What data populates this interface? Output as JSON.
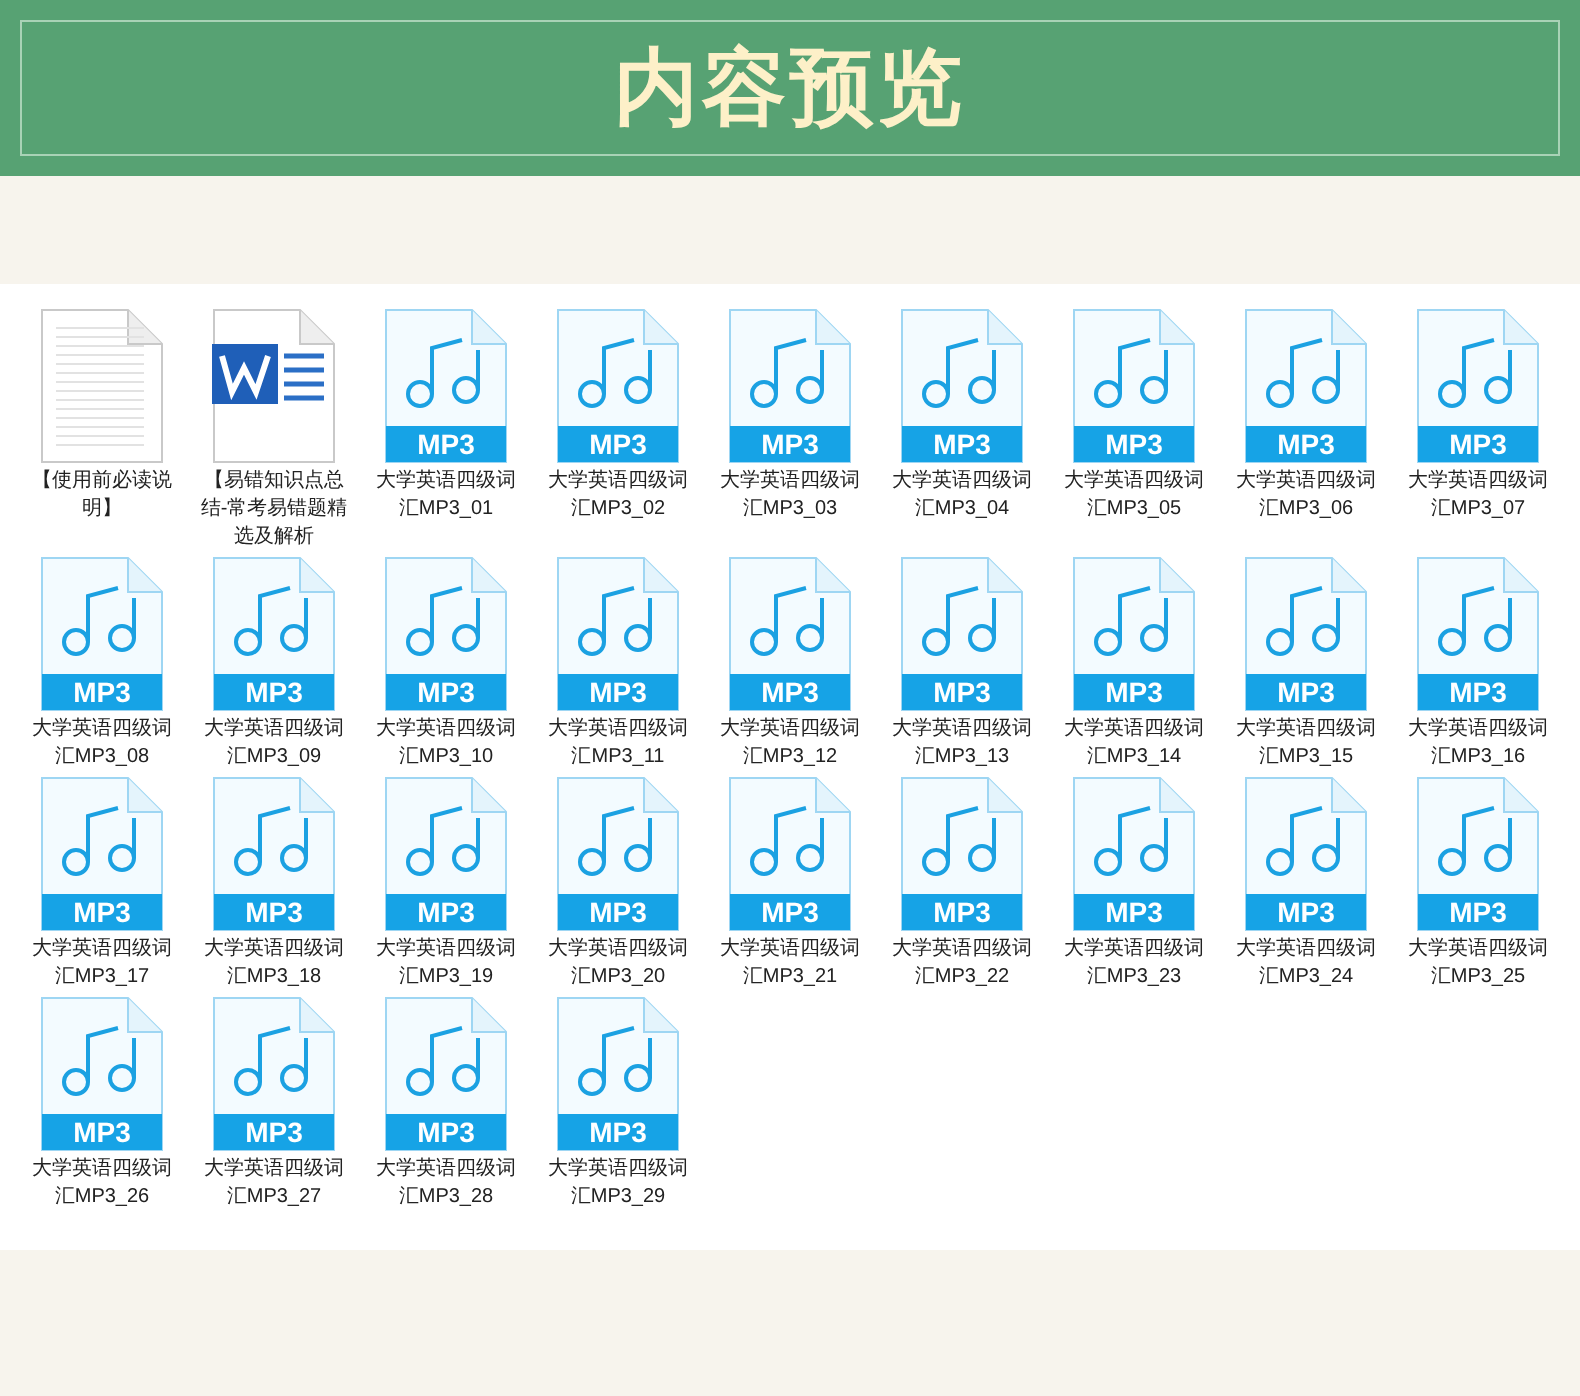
{
  "header": {
    "title": "内容预览"
  },
  "files": [
    {
      "kind": "blank",
      "label": "【使用前必读说明】"
    },
    {
      "kind": "word",
      "label": "【易错知识点总结-常考易错题精选及解析"
    },
    {
      "kind": "mp3",
      "badge": "MP3",
      "label": "大学英语四级词汇MP3_01"
    },
    {
      "kind": "mp3",
      "badge": "MP3",
      "label": "大学英语四级词汇MP3_02"
    },
    {
      "kind": "mp3",
      "badge": "MP3",
      "label": "大学英语四级词汇MP3_03"
    },
    {
      "kind": "mp3",
      "badge": "MP3",
      "label": "大学英语四级词汇MP3_04"
    },
    {
      "kind": "mp3",
      "badge": "MP3",
      "label": "大学英语四级词汇MP3_05"
    },
    {
      "kind": "mp3",
      "badge": "MP3",
      "label": "大学英语四级词汇MP3_06"
    },
    {
      "kind": "mp3",
      "badge": "MP3",
      "label": "大学英语四级词汇MP3_07"
    },
    {
      "kind": "mp3",
      "badge": "MP3",
      "label": "大学英语四级词汇MP3_08"
    },
    {
      "kind": "mp3",
      "badge": "MP3",
      "label": "大学英语四级词汇MP3_09"
    },
    {
      "kind": "mp3",
      "badge": "MP3",
      "label": "大学英语四级词汇MP3_10"
    },
    {
      "kind": "mp3",
      "badge": "MP3",
      "label": "大学英语四级词汇MP3_11"
    },
    {
      "kind": "mp3",
      "badge": "MP3",
      "label": "大学英语四级词汇MP3_12"
    },
    {
      "kind": "mp3",
      "badge": "MP3",
      "label": "大学英语四级词汇MP3_13"
    },
    {
      "kind": "mp3",
      "badge": "MP3",
      "label": "大学英语四级词汇MP3_14"
    },
    {
      "kind": "mp3",
      "badge": "MP3",
      "label": "大学英语四级词汇MP3_15"
    },
    {
      "kind": "mp3",
      "badge": "MP3",
      "label": "大学英语四级词汇MP3_16"
    },
    {
      "kind": "mp3",
      "badge": "MP3",
      "label": "大学英语四级词汇MP3_17"
    },
    {
      "kind": "mp3",
      "badge": "MP3",
      "label": "大学英语四级词汇MP3_18"
    },
    {
      "kind": "mp3",
      "badge": "MP3",
      "label": "大学英语四级词汇MP3_19"
    },
    {
      "kind": "mp3",
      "badge": "MP3",
      "label": "大学英语四级词汇MP3_20"
    },
    {
      "kind": "mp3",
      "badge": "MP3",
      "label": "大学英语四级词汇MP3_21"
    },
    {
      "kind": "mp3",
      "badge": "MP3",
      "label": "大学英语四级词汇MP3_22"
    },
    {
      "kind": "mp3",
      "badge": "MP3",
      "label": "大学英语四级词汇MP3_23"
    },
    {
      "kind": "mp3",
      "badge": "MP3",
      "label": "大学英语四级词汇MP3_24"
    },
    {
      "kind": "mp3",
      "badge": "MP3",
      "label": "大学英语四级词汇MP3_25"
    },
    {
      "kind": "mp3",
      "badge": "MP3",
      "label": "大学英语四级词汇MP3_26"
    },
    {
      "kind": "mp3",
      "badge": "MP3",
      "label": "大学英语四级词汇MP3_27"
    },
    {
      "kind": "mp3",
      "badge": "MP3",
      "label": "大学英语四级词汇MP3_28"
    },
    {
      "kind": "mp3",
      "badge": "MP3",
      "label": "大学英语四级词汇MP3_29"
    }
  ]
}
